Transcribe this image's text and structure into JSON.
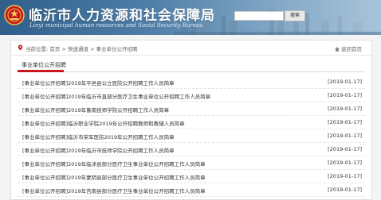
{
  "header": {
    "title": "临沂市人力资源和社会保障局",
    "subtitle": "Linyi municipal human resources and Social Security Bureau",
    "search_button": "搜索",
    "search_value": ""
  },
  "breadcrumb": {
    "prefix": "当前位置:",
    "items": [
      "首页",
      "快速通道",
      "事业单位公开招聘"
    ],
    "separator": " > ",
    "back_label": "返回首页"
  },
  "section": {
    "tab_label": "事业单位公开招聘",
    "accent_color": "#c8161d"
  },
  "list": [
    {
      "title": "[事业单位公开招聘]2019年平邑县公立医院公开招聘工作人员简章",
      "date": "[2019-01-17]"
    },
    {
      "title": "[事业单位公开招聘]2019年临沂市直部分医疗卫生事业单位公开招聘工作人员简章",
      "date": "[2019-01-17]"
    },
    {
      "title": "[事业单位公开招聘]2019年鲁南技师学院公开招聘工作人员简章",
      "date": "[2019-01-17]"
    },
    {
      "title": "[事业单位公开招聘]临沂职业学院2019年公开招聘教师和教辅人员简章",
      "date": "[2019-01-17]"
    },
    {
      "title": "[事业单位公开招聘]临沂市荣军医院2019年公开招聘工作人员简章",
      "date": "[2019-01-17]"
    },
    {
      "title": "[事业单位公开招聘]2019年临沂市技师学院公开招聘工作人员简章",
      "date": "[2019-01-17]"
    },
    {
      "title": "[事业单位公开招聘]2019年临沭县部分医疗卫生事业单位公开招聘工作人员简章",
      "date": "[2019-01-17]"
    },
    {
      "title": "[事业单位公开招聘]2019年蒙阴县部分医疗卫生事业单位公开招聘工作人员简章",
      "date": "[2019-01-17]"
    },
    {
      "title": "[事业单位公开招聘]2019年莒南县部分医疗卫生事业单位公开招聘工作人员简章",
      "date": "[2019-01-17]"
    }
  ]
}
